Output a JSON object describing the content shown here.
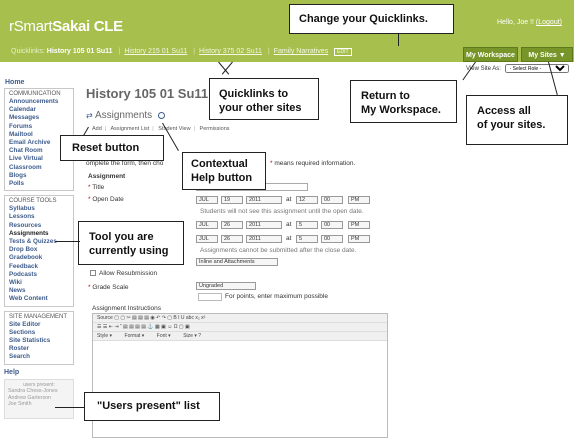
{
  "header": {
    "logo_prefix": "rSmart",
    "logo_main": "Sakai CLE",
    "hello": "Hello, Joe !!",
    "logout": "(Logout)",
    "quicklinks_label": "Quicklinks:",
    "quicklinks": [
      "History 105 01 Su11",
      "History 215 01 Su11",
      "History 375 02 Su11",
      "Family Narratives"
    ],
    "quicklinks_badge": "EDIT",
    "my_workspace": "My Workspace",
    "my_sites": "My Sites ▼",
    "view_site_as": "View Site As:",
    "select_role": "- Select Role -"
  },
  "sidebar": {
    "home": "Home",
    "communication": {
      "title": "COMMUNICATION",
      "items": [
        "Announcements",
        "Calendar",
        "Messages",
        "Forums",
        "Mailtool",
        "Email Archive",
        "Chat Room",
        "Live Virtual Classroom",
        "Blogs",
        "Polls"
      ]
    },
    "course_tools": {
      "title": "COURSE TOOLS",
      "items": [
        "Syllabus",
        "Lessons",
        "Resources",
        "Assignments",
        "Tests & Quizzes",
        "Drop Box",
        "Gradebook",
        "Feedback",
        "Podcasts",
        "Wiki",
        "News",
        "Web Content"
      ]
    },
    "site_management": {
      "title": "SITE MANAGEMENT",
      "items": [
        "Site Editor",
        "Sections",
        "Site Statistics",
        "Roster",
        "Search"
      ]
    },
    "help": "Help",
    "users_present_title": "users present:",
    "users_present": [
      "Sandra Chess-Jones",
      "Andrew Garterson",
      "Joe Smith"
    ]
  },
  "main": {
    "site_title": "History 105 01 Su11",
    "tool_title": "Assignments",
    "tabs": [
      "Add",
      "Assignment List",
      "Student View",
      "Permissions"
    ],
    "required_note": "means required information.",
    "required_prefix": "omplete the form, then cho",
    "section_assignment": "Assignment",
    "title_label": "Title",
    "open_date_label": "Open Date",
    "open_date": {
      "month": "JUL",
      "day": "19",
      "year": "2011",
      "at": "at",
      "hour": "12",
      "minute": "00",
      "ampm": "PM"
    },
    "open_note": "Students will not see this assignment until the open date.",
    "due_date": {
      "month": "JUL",
      "day": "26",
      "year": "2011",
      "at": "at",
      "hour": "5",
      "minute": "00",
      "ampm": "PM"
    },
    "close_date": {
      "month": "JUL",
      "day": "26",
      "year": "2011",
      "at": "at",
      "hour": "5",
      "minute": "00",
      "ampm": "PM"
    },
    "close_note": "Assignments cannot be submitted after the close date.",
    "submission_type": "Inline and Attachments",
    "allow_resubmission": "Allow Resubmission",
    "grade_scale_label": "Grade Scale",
    "grade_scale": "Ungraded",
    "points_note": "For points, enter maximum possible",
    "instructions_label": "Assignment Instructions",
    "editor_toolbar_1": "Source",
    "editor_style": "Style",
    "editor_format": "Format",
    "editor_font": "Font",
    "editor_size": "Size"
  },
  "callouts": {
    "change_quicklinks": "Change your Quicklinks.",
    "quicklinks_other": "Quicklinks to\nyour other sites",
    "return_workspace": "Return to\nMy Workspace.",
    "access_sites": "Access all\nof your sites.",
    "reset_button": "Reset button",
    "contextual_help": "Contextual\nHelp button",
    "tool_using": "Tool you are\ncurrently using",
    "users_present": "\"Users present\" list"
  }
}
